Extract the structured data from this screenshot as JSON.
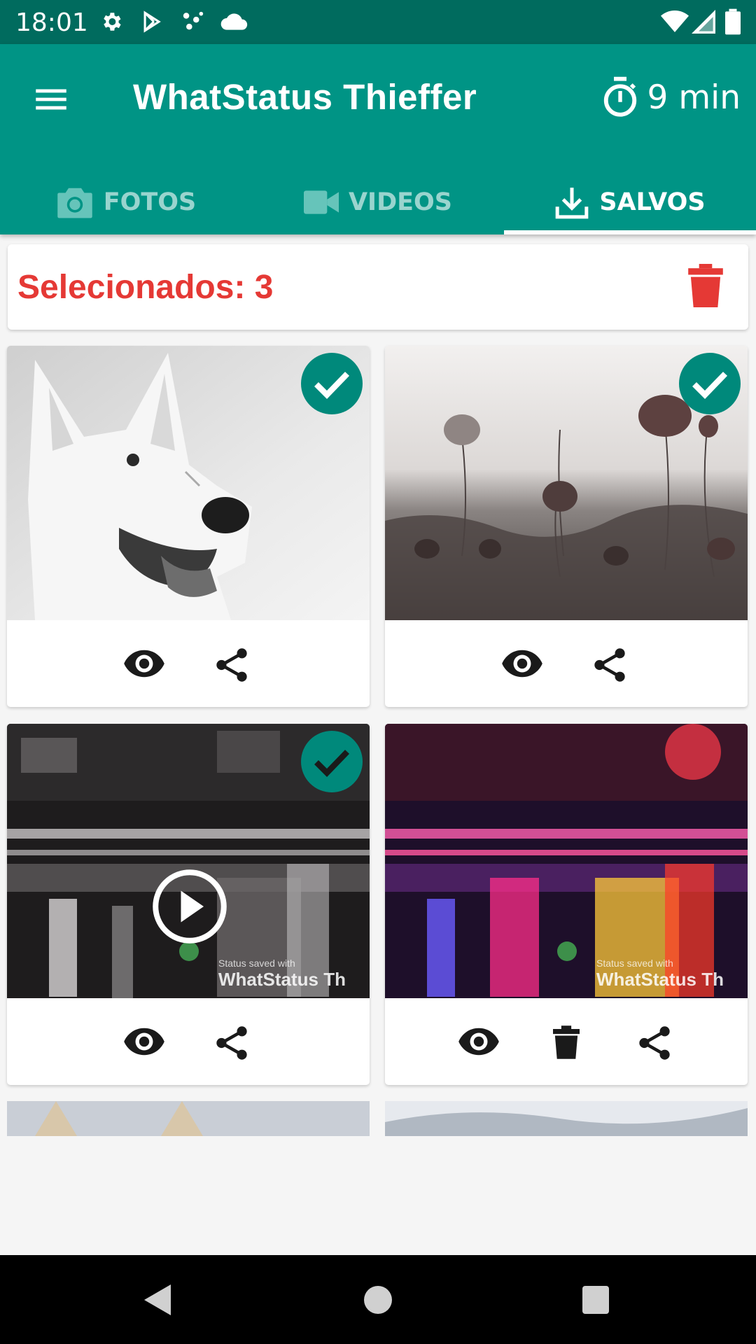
{
  "status_bar": {
    "time": "18:01"
  },
  "app_bar": {
    "title": "WhatStatus Thieffer",
    "timer_label": "9 min"
  },
  "tabs": [
    {
      "label": "FOTOS",
      "icon": "camera-icon",
      "active": false
    },
    {
      "label": "VIDEOS",
      "icon": "videocam-icon",
      "active": false
    },
    {
      "label": "SALVOS",
      "icon": "download-icon",
      "active": true
    }
  ],
  "selection": {
    "label": "Selecionados: 3"
  },
  "items": [
    {
      "name": "white-dog-photo",
      "selected": true,
      "type": "image",
      "actions": [
        "view",
        "share"
      ]
    },
    {
      "name": "poppies-photo",
      "selected": true,
      "type": "image",
      "actions": [
        "view",
        "share"
      ]
    },
    {
      "name": "rainy-street-video",
      "selected": true,
      "type": "video",
      "watermark_small": "Status saved with",
      "watermark_big": "WhatStatus Th",
      "actions": [
        "view",
        "share"
      ]
    },
    {
      "name": "colorful-street-video",
      "selected": false,
      "type": "video",
      "watermark_small": "Status saved with",
      "watermark_big": "WhatStatus Th",
      "actions": [
        "view",
        "delete",
        "share"
      ]
    }
  ],
  "colors": {
    "primary": "#009485",
    "primary_dark": "#006b5e",
    "accent_red": "#e53935",
    "check_teal": "#00897b"
  }
}
